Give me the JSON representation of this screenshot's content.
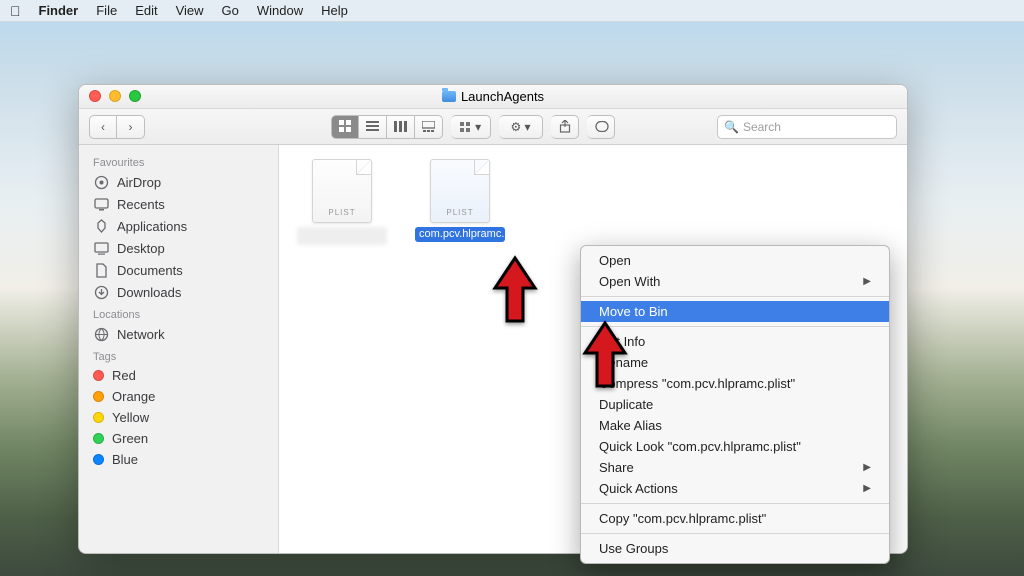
{
  "menubar": {
    "app": "Finder",
    "items": [
      "File",
      "Edit",
      "View",
      "Go",
      "Window",
      "Help"
    ]
  },
  "window": {
    "title": "LaunchAgents",
    "search_placeholder": "Search"
  },
  "sidebar": {
    "sections": [
      {
        "title": "Favourites",
        "items": [
          {
            "icon": "airdrop",
            "label": "AirDrop"
          },
          {
            "icon": "recents",
            "label": "Recents"
          },
          {
            "icon": "apps",
            "label": "Applications"
          },
          {
            "icon": "desktop",
            "label": "Desktop"
          },
          {
            "icon": "docs",
            "label": "Documents"
          },
          {
            "icon": "downloads",
            "label": "Downloads"
          }
        ]
      },
      {
        "title": "Locations",
        "items": [
          {
            "icon": "network",
            "label": "Network"
          }
        ]
      },
      {
        "title": "Tags",
        "items": [
          {
            "tag": "#ff5b50",
            "label": "Red"
          },
          {
            "tag": "#ff9f0a",
            "label": "Orange"
          },
          {
            "tag": "#ffd60a",
            "label": "Yellow"
          },
          {
            "tag": "#30d158",
            "label": "Green"
          },
          {
            "tag": "#0a84ff",
            "label": "Blue"
          }
        ]
      }
    ]
  },
  "files": [
    {
      "ext": "PLIST",
      "name": "",
      "blurred": true
    },
    {
      "ext": "PLIST",
      "name": "com.pcv.hlpramc.plist",
      "selected": true
    }
  ],
  "context_menu": {
    "items": [
      {
        "label": "Open"
      },
      {
        "label": "Open With",
        "submenu": true
      },
      {
        "sep": true
      },
      {
        "label": "Move to Bin",
        "highlight": true
      },
      {
        "sep": true
      },
      {
        "label": "Get Info"
      },
      {
        "label": "Rename"
      },
      {
        "label": "Compress \"com.pcv.hlpramc.plist\""
      },
      {
        "label": "Duplicate"
      },
      {
        "label": "Make Alias"
      },
      {
        "label": "Quick Look \"com.pcv.hlpramc.plist\""
      },
      {
        "label": "Share",
        "submenu": true
      },
      {
        "label": "Quick Actions",
        "submenu": true
      },
      {
        "sep": true
      },
      {
        "label": "Copy \"com.pcv.hlpramc.plist\""
      },
      {
        "sep": true
      },
      {
        "label": "Use Groups"
      }
    ]
  }
}
